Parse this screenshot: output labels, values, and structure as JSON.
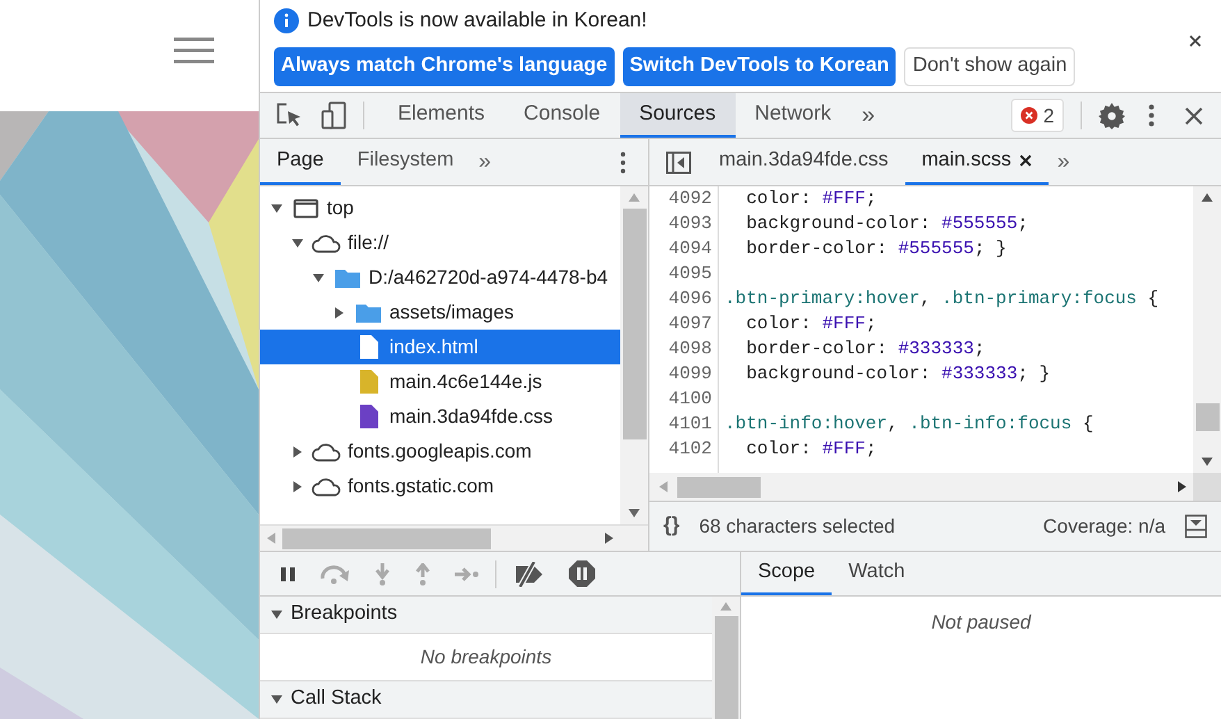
{
  "infobar": {
    "message": "DevTools is now available in Korean!",
    "buttons": [
      {
        "label": "Always match Chrome's language",
        "kind": "primary"
      },
      {
        "label": "Switch DevTools to Korean",
        "kind": "primary"
      },
      {
        "label": "Don't show again",
        "kind": "secondary"
      }
    ]
  },
  "toolbar": {
    "tabs": [
      {
        "label": "Elements",
        "selected": false
      },
      {
        "label": "Console",
        "selected": false
      },
      {
        "label": "Sources",
        "selected": true
      },
      {
        "label": "Network",
        "selected": false
      }
    ],
    "more": "»",
    "error_count": "2"
  },
  "navigator": {
    "tabs": [
      {
        "label": "Page",
        "selected": true
      },
      {
        "label": "Filesystem",
        "selected": false
      }
    ],
    "more": "»",
    "tree": [
      {
        "label": "top",
        "kind": "frame",
        "expanded": true,
        "selected": false,
        "children": [
          {
            "label": "file://",
            "kind": "cloud",
            "expanded": true,
            "selected": false,
            "children": [
              {
                "label": "D:/a462720d-a974-4478-b4",
                "kind": "folder",
                "expanded": true,
                "selected": false,
                "children": [
                  {
                    "label": "assets/images",
                    "kind": "folder",
                    "expanded": false,
                    "selected": false
                  },
                  {
                    "label": "index.html",
                    "kind": "document",
                    "selected": true
                  },
                  {
                    "label": "main.4c6e144e.js",
                    "kind": "script",
                    "selected": false
                  },
                  {
                    "label": "main.3da94fde.css",
                    "kind": "stylesheet",
                    "selected": false
                  }
                ]
              }
            ]
          },
          {
            "label": "fonts.googleapis.com",
            "kind": "cloud",
            "expanded": false,
            "selected": false
          },
          {
            "label": "fonts.gstatic.com",
            "kind": "cloud",
            "expanded": false,
            "selected": false
          }
        ]
      }
    ]
  },
  "editor": {
    "tabs": [
      {
        "label": "main.3da94fde.css",
        "selected": false,
        "closable": false
      },
      {
        "label": "main.scss",
        "selected": true,
        "closable": true
      }
    ],
    "more": "»",
    "lines": [
      {
        "number": "4092",
        "tokens": [
          {
            "kind": "plain",
            "text": "  color: "
          },
          {
            "kind": "value",
            "text": "#FFF"
          },
          {
            "kind": "plain",
            "text": ";"
          }
        ]
      },
      {
        "number": "4093",
        "tokens": [
          {
            "kind": "plain",
            "text": "  background-color: "
          },
          {
            "kind": "value",
            "text": "#555555"
          },
          {
            "kind": "plain",
            "text": ";"
          }
        ]
      },
      {
        "number": "4094",
        "tokens": [
          {
            "kind": "plain",
            "text": "  border-color: "
          },
          {
            "kind": "value",
            "text": "#555555"
          },
          {
            "kind": "plain",
            "text": "; }"
          }
        ]
      },
      {
        "number": "4095"
      },
      {
        "number": "4096",
        "tokens": [
          {
            "kind": "selector",
            "text": ".btn-primary:hover"
          },
          {
            "kind": "plain",
            "text": ", "
          },
          {
            "kind": "selector",
            "text": ".btn-primary:focus"
          },
          {
            "kind": "plain",
            "text": " {"
          }
        ]
      },
      {
        "number": "4097",
        "tokens": [
          {
            "kind": "plain",
            "text": "  color: "
          },
          {
            "kind": "value",
            "text": "#FFF"
          },
          {
            "kind": "plain",
            "text": ";"
          }
        ]
      },
      {
        "number": "4098",
        "tokens": [
          {
            "kind": "plain",
            "text": "  border-color: "
          },
          {
            "kind": "value",
            "text": "#333333"
          },
          {
            "kind": "plain",
            "text": ";"
          }
        ]
      },
      {
        "number": "4099",
        "tokens": [
          {
            "kind": "plain",
            "text": "  background-color: "
          },
          {
            "kind": "value",
            "text": "#333333"
          },
          {
            "kind": "plain",
            "text": "; }"
          }
        ]
      },
      {
        "number": "4100"
      },
      {
        "number": "4101",
        "tokens": [
          {
            "kind": "selector",
            "text": ".btn-info:hover"
          },
          {
            "kind": "plain",
            "text": ", "
          },
          {
            "kind": "selector",
            "text": ".btn-info:focus"
          },
          {
            "kind": "plain",
            "text": " {"
          }
        ]
      },
      {
        "number": "4102",
        "tokens": [
          {
            "kind": "plain",
            "text": "  color: "
          },
          {
            "kind": "value",
            "text": "#FFF"
          },
          {
            "kind": "plain",
            "text": ";"
          }
        ]
      }
    ],
    "status": {
      "format": "{}",
      "selection": "68 characters selected",
      "coverage": "Coverage: n/a"
    }
  },
  "debugger": {
    "sections": [
      {
        "title": "Breakpoints",
        "expanded": true,
        "empty_text": "No breakpoints"
      },
      {
        "title": "Call Stack",
        "expanded": true
      }
    ],
    "side_tabs": [
      {
        "label": "Scope",
        "selected": true
      },
      {
        "label": "Watch",
        "selected": false
      }
    ],
    "side_text": "Not paused"
  }
}
